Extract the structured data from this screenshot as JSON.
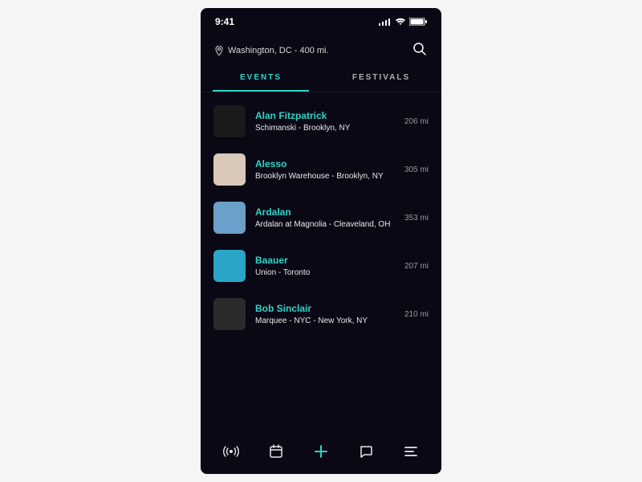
{
  "status": {
    "time": "9:41"
  },
  "location": {
    "text": "Washington, DC - 400 mi."
  },
  "tabs": {
    "events": "EVENTS",
    "festivals": "FESTIVALS"
  },
  "events": [
    {
      "name": "Alan Fitzpatrick",
      "venue": "Schimanski - Brooklyn, NY",
      "distance": "206 mi"
    },
    {
      "name": "Alesso",
      "venue": "Brooklyn Warehouse - Brooklyn, NY",
      "distance": "305 mi"
    },
    {
      "name": "Ardalan",
      "venue": "Ardalan at Magnolia - Cleaveland, OH",
      "distance": "353 mi"
    },
    {
      "name": "Baauer",
      "venue": "Union - Toronto",
      "distance": "207 mi"
    },
    {
      "name": "Bob Sinclair",
      "venue": "Marquee - NYC - New York, NY",
      "distance": "210 mi"
    }
  ],
  "colors": {
    "accent": "#2dd4c9",
    "bg": "#0a0815"
  }
}
